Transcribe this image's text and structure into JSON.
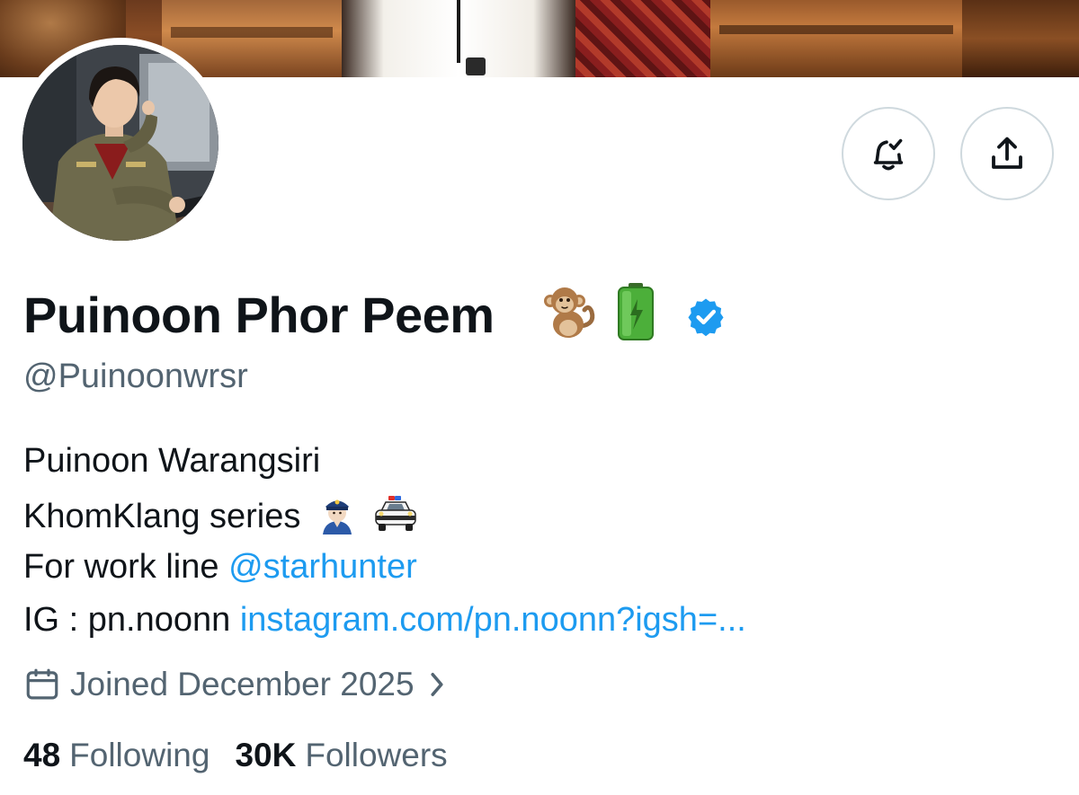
{
  "profile": {
    "display_name": "Puinoon Phor Peem",
    "name_emojis": [
      "monkey",
      "battery"
    ],
    "verified": true,
    "handle": "@Puinoonwrsr"
  },
  "actions": {
    "notify_icon": "bell-check-icon",
    "share_icon": "share-upload-icon"
  },
  "bio": {
    "line1": "Puinoon Warangsiri",
    "line2_text": "KhomKlang series",
    "line2_emojis": [
      "police-officer",
      "police-car"
    ],
    "line3_text": "For work line",
    "line3_link": "@starhunter",
    "line4_text": "IG : pn.noonn",
    "line4_link": "instagram.com/pn.noonn?igsh=..."
  },
  "joined": {
    "text": "Joined December 2025",
    "icon": "calendar-icon"
  },
  "stats": {
    "following_count": "48",
    "following_label": "Following",
    "followers_count": "30K",
    "followers_label": "Followers"
  },
  "colors": {
    "text": "#0f1419",
    "secondary": "#536471",
    "link": "#1d9bf0",
    "border": "#cfd9de"
  }
}
